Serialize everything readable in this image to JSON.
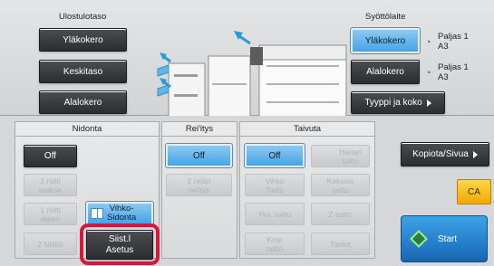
{
  "output": {
    "title": "Ulostulotaso",
    "buttons": [
      "Yläkokero",
      "Keskitaso",
      "Alalokero"
    ]
  },
  "feed": {
    "title": "Syöttölaite",
    "upper_tray": "Yläkokero",
    "lower_tray": "Alalokero",
    "upper_tray_status": "Paljas 1",
    "upper_tray_size": "A3",
    "lower_tray_status": "Paljas 1",
    "lower_tray_size": "A3",
    "type_size_button": "Tyyppi ja koko"
  },
  "stapling": {
    "title": "Nidonta",
    "off": "Off",
    "one_staple_back": "1 niitti\ntaakse",
    "one_staple_front": "1 niitti\neteen",
    "two_staples": "2 Niittiä",
    "saddle_stitch": "Vihko-\nSidonta",
    "settings": "Siist.l\nAsetus"
  },
  "punch": {
    "title": "Rei'itys",
    "off": "Off",
    "two_holes": "2 reiän\nrei'itys"
  },
  "fold": {
    "title": "Taivuta",
    "off": "Off",
    "z_fold_half": "Haitari\ntaitto",
    "booklet_fold": "Vihko\nTaitto",
    "double_fold": "Kaksois\ntaitto",
    "single_fold": "Yks. taitto",
    "z_fold": "Z-taitto",
    "letter_fold": "Kirje\ntaitto",
    "info": "Tiedot"
  },
  "right": {
    "copies_per_side": "Kopiota/Sivua",
    "ca": "CA",
    "start": "Start"
  },
  "colors": {
    "selected_blue": "#47a3e4",
    "highlight_red": "#d6193a",
    "ca_yellow": "#f2a900",
    "start_blue": "#1766b6"
  }
}
